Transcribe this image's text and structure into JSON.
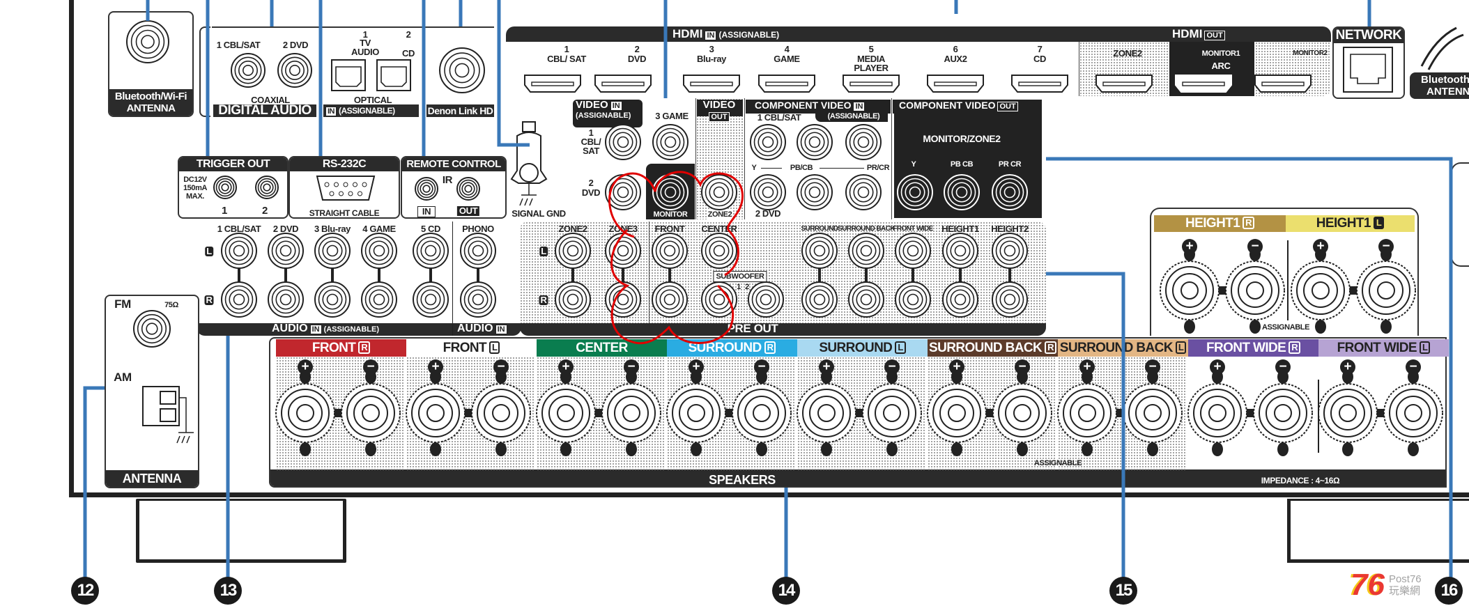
{
  "colors": {
    "leader": "#3a78b8",
    "annotation": "#e00000",
    "panel": "#2b2b2b"
  },
  "bt_antenna": {
    "line1": "Bluetooth/Wi-Fi",
    "line2": "ANTENNA"
  },
  "digital_audio": {
    "coax_1": "1 CBL/SAT",
    "coax_2": "2 DVD",
    "coax_label": "COAXIAL",
    "opt_1_num": "1",
    "opt_1_a": "TV",
    "opt_1_b": "AUDIO",
    "opt_2_num": "2",
    "opt_2": "CD",
    "opt_label": "OPTICAL",
    "title": "DIGITAL AUDIO",
    "in_badge": "IN",
    "assignable": "(ASSIGNABLE)"
  },
  "denon_link": "Denon Link HD",
  "hdmi_in": {
    "title": "HDMI",
    "badge": "IN",
    "assignable": "(ASSIGNABLE)",
    "ports": [
      {
        "num": "1",
        "label": "CBL/ SAT"
      },
      {
        "num": "2",
        "label": "DVD"
      },
      {
        "num": "3",
        "label": "Blu-ray"
      },
      {
        "num": "4",
        "label": "GAME"
      },
      {
        "num": "5",
        "label": "MEDIA PLAYER"
      },
      {
        "num": "6",
        "label": "AUX2"
      },
      {
        "num": "7",
        "label": "CD"
      }
    ]
  },
  "hdmi_out": {
    "title": "HDMI",
    "badge": "OUT",
    "zone2": "ZONE2",
    "monitor1": "MONITOR1",
    "arc": "ARC",
    "monitor2": "MONITOR2"
  },
  "network": "NETWORK",
  "bt_right": {
    "line1": "Bluetooth/Wi-Fi",
    "line2": "ANTENNA"
  },
  "trigger_out": {
    "title": "TRIGGER OUT",
    "spec1": "DC12V",
    "spec2": "150mA",
    "spec3": "MAX.",
    "port1": "1",
    "port2": "2"
  },
  "rs232c": {
    "title": "RS-232C",
    "note": "STRAIGHT CABLE"
  },
  "remote": {
    "title": "REMOTE CONTROL",
    "ir": "IR",
    "in": "IN",
    "out": "OUT"
  },
  "signal_gnd": "SIGNAL GND",
  "video_in": {
    "title": "VIDEO",
    "badge": "IN",
    "assignable": "(ASSIGNABLE)",
    "in1_num": "1",
    "in1_a": "CBL/",
    "in1_b": "SAT",
    "in3": "3 GAME",
    "in2_num": "2",
    "in2": "DVD"
  },
  "video_out": {
    "title": "VIDEO",
    "badge": "OUT",
    "monitor": "MONITOR",
    "zone2": "ZONE2"
  },
  "component_in": {
    "title": "COMPONENT VIDEO",
    "badge": "IN",
    "assignable": "(ASSIGNABLE)",
    "in1": "1 CBL/SAT",
    "y": "Y",
    "pb": "PB/CB",
    "pr": "PR/CR",
    "in2": "2 DVD"
  },
  "component_out": {
    "title": "COMPONENT VIDEO",
    "badge": "OUT",
    "label": "MONITOR/ZONE2",
    "y": "Y",
    "pb": "PB CB",
    "pr": "PR CR"
  },
  "audio_in": {
    "columns": [
      "1 CBL/SAT",
      "2 DVD",
      "3 Blu-ray",
      "4 GAME",
      "5 CD"
    ],
    "phono": "PHONO",
    "left": "L",
    "right": "R",
    "footer": "AUDIO",
    "badge": "IN",
    "assignable": "(ASSIGNABLE)",
    "phono_footer": "AUDIO",
    "phono_badge": "IN"
  },
  "pre_out": {
    "columns": [
      "ZONE2",
      "ZONE3",
      "FRONT",
      "CENTER",
      "SURROUND",
      "SURROUND BACK",
      "FRONT WIDE",
      "HEIGHT1",
      "HEIGHT2"
    ],
    "subwoofer": "SUBWOOFER",
    "sub1": "1",
    "sub2": "2",
    "left": "L",
    "right": "R",
    "footer": "PRE OUT"
  },
  "height": {
    "r_label": "HEIGHT1",
    "r_side": "R",
    "r_color": "#b39244",
    "l_label": "HEIGHT1",
    "l_side": "L",
    "l_color": "#ebdf6e",
    "assignable": "ASSIGNABLE"
  },
  "antenna": {
    "fm": "FM",
    "ohm": "75Ω",
    "am": "AM",
    "title": "ANTENNA"
  },
  "speakers": {
    "groups": [
      {
        "label": "FRONT",
        "side": "R",
        "color": "#c1272d",
        "text": "#ffffff"
      },
      {
        "label": "FRONT",
        "side": "L",
        "color": "#ffffff",
        "text": "#222222"
      },
      {
        "label": "CENTER",
        "side": "",
        "color": "#0a7d4f",
        "text": "#ffffff"
      },
      {
        "label": "SURROUND",
        "side": "R",
        "color": "#2aace2",
        "text": "#ffffff"
      },
      {
        "label": "SURROUND",
        "side": "L",
        "color": "#a9d9f1",
        "text": "#222222"
      },
      {
        "label": "SURROUND BACK",
        "side": "R",
        "color": "#5c3b2a",
        "text": "#ffffff"
      },
      {
        "label": "SURROUND BACK",
        "side": "L",
        "color": "#e3b684",
        "text": "#222222"
      },
      {
        "label": "FRONT WIDE",
        "side": "R",
        "color": "#6a50a2",
        "text": "#ffffff"
      },
      {
        "label": "FRONT WIDE",
        "side": "L",
        "color": "#b6a3d3",
        "text": "#222222"
      }
    ],
    "plus": "+",
    "minus": "−",
    "assignable": "ASSIGNABLE",
    "footer": "SPEAKERS",
    "impedance": "IMPEDANCE : 4~16Ω"
  },
  "callouts": [
    "12",
    "13",
    "14",
    "15",
    "16"
  ],
  "watermark": {
    "logo": "76",
    "text1": "Post76",
    "text2": "玩樂網"
  }
}
